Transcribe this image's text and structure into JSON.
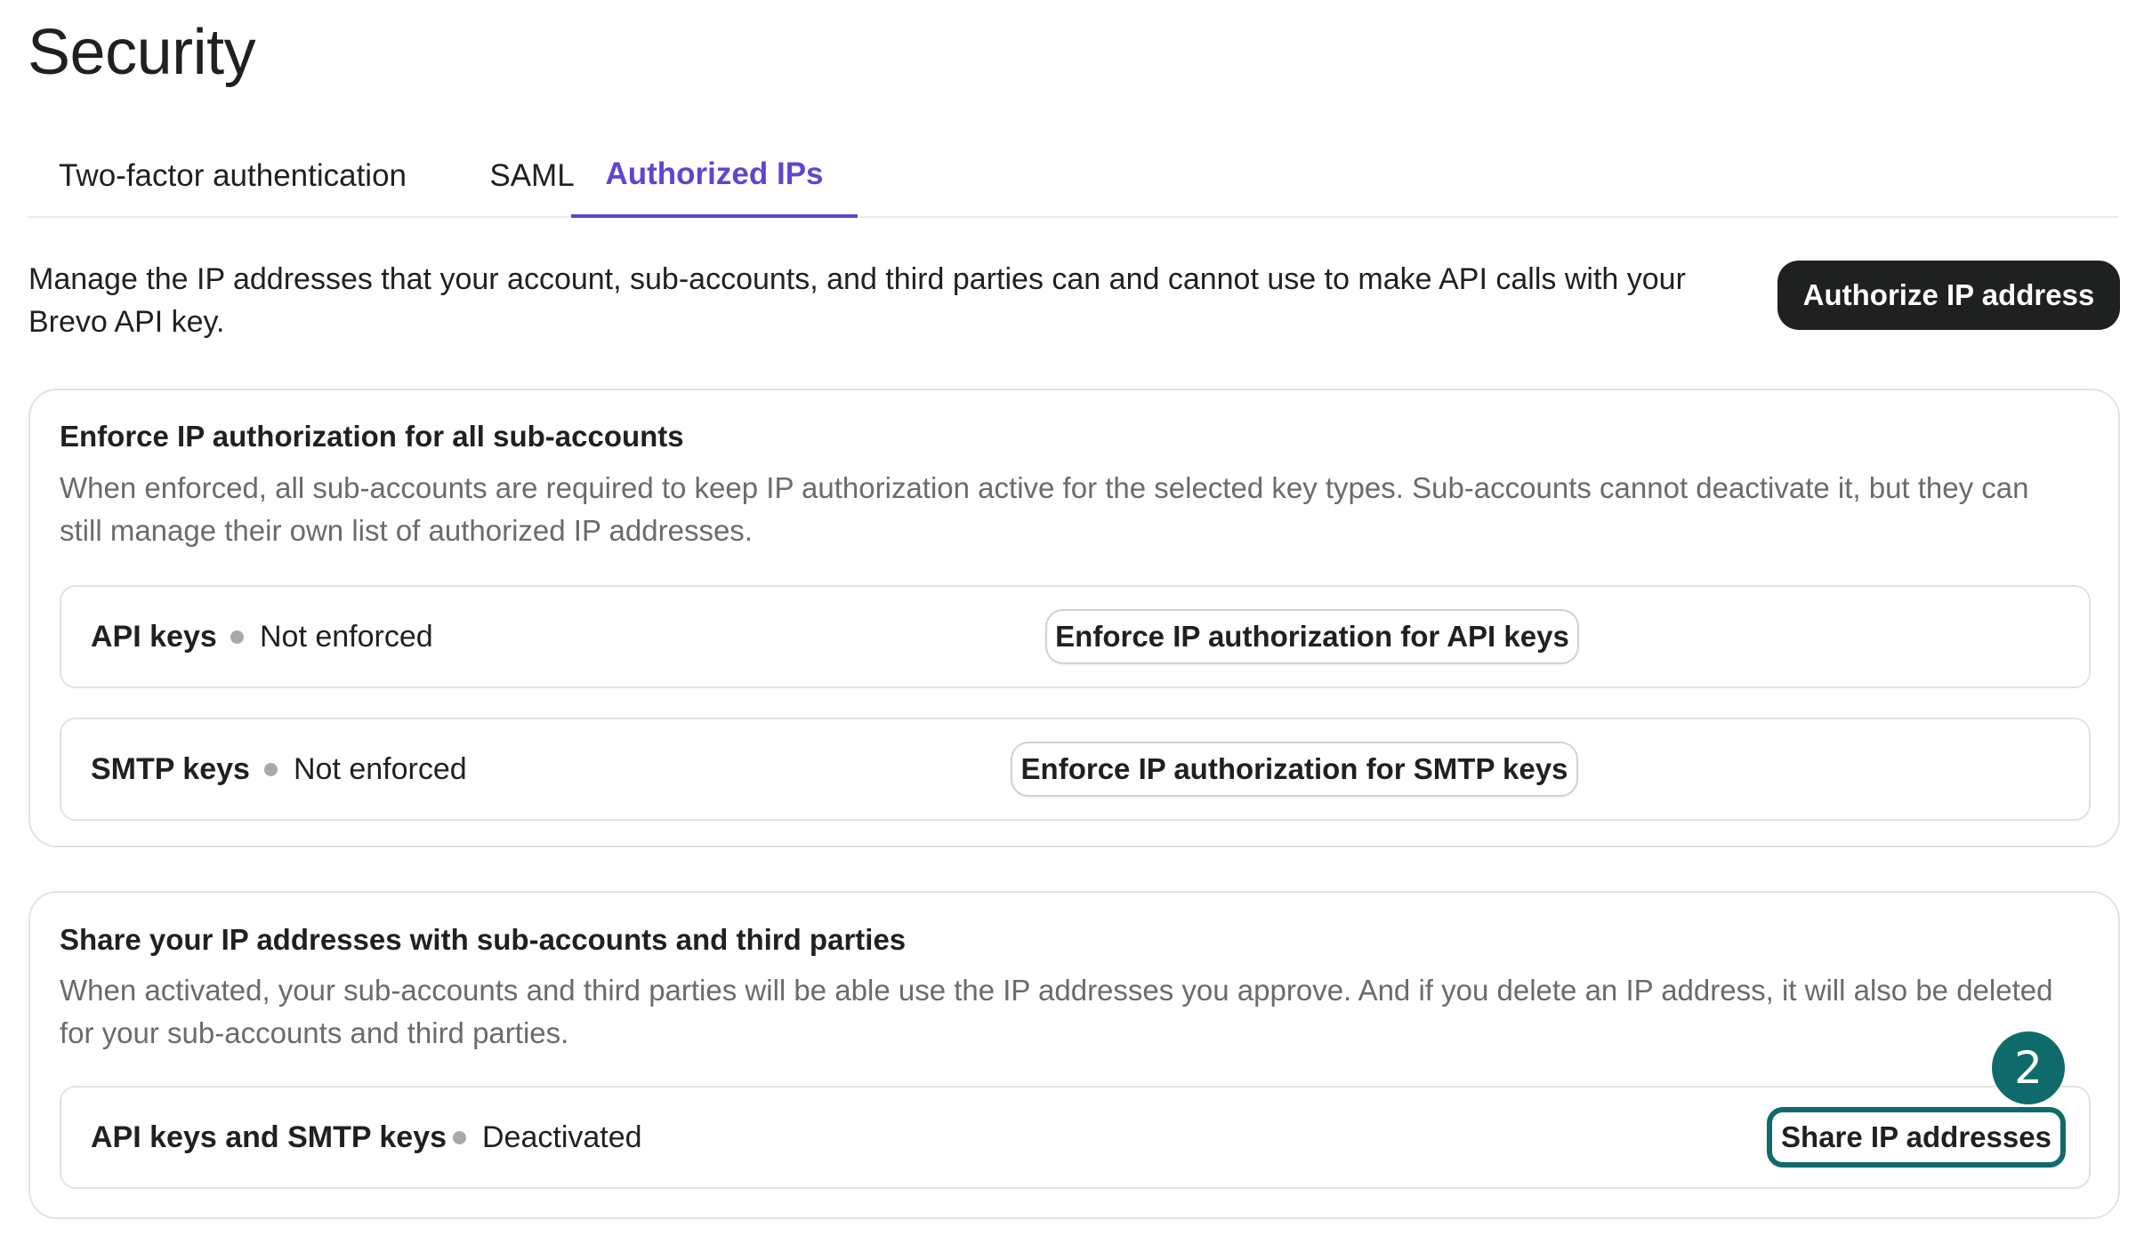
{
  "page": {
    "title": "Security"
  },
  "tabs": [
    {
      "label": "Two-factor authentication",
      "active": false
    },
    {
      "label": "SAML",
      "active": false
    },
    {
      "label": "Authorized IPs",
      "active": true
    }
  ],
  "intro": {
    "text": "Manage the IP addresses that your account, sub-accounts, and third parties can and cannot use to make API calls with your Brevo API key.",
    "button_label": "Authorize IP address"
  },
  "enforce_card": {
    "title": "Enforce IP authorization for all sub-accounts",
    "description": "When enforced, all sub-accounts are required to keep IP authorization active for the selected key types. Sub-accounts cannot deactivate it, but they can still manage their own list of authorized IP addresses.",
    "rows": [
      {
        "label": "API keys",
        "status": "Not enforced",
        "button_label": "Enforce IP authorization for API keys"
      },
      {
        "label": "SMTP keys",
        "status": "Not enforced",
        "button_label": "Enforce IP authorization for SMTP keys"
      }
    ]
  },
  "share_card": {
    "title": "Share your IP addresses with sub-accounts and third parties",
    "description": "When activated, your sub-accounts and third parties will be able use the IP addresses you approve. And if you delete an IP address, it will also be deleted for your sub-accounts and third parties.",
    "row": {
      "label": "API keys and SMTP keys",
      "status": "Deactivated",
      "button_label": "Share IP addresses"
    }
  },
  "step_badge": {
    "number": "2"
  },
  "colors": {
    "accent": "#5a48d1",
    "primary_button": "#1f2020",
    "highlight": "#0f6b6b",
    "status_dot": "#a9a9a9"
  }
}
